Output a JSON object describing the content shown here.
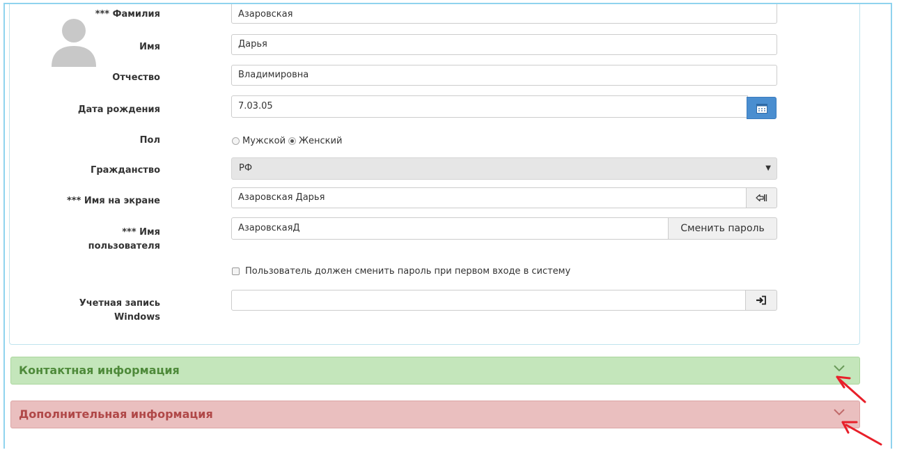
{
  "form": {
    "surname": {
      "label": "*** Фамилия",
      "value": "Азаровская"
    },
    "first_name": {
      "label": "Имя",
      "value": "Дарья"
    },
    "patronymic": {
      "label": "Отчество",
      "value": "Владимировна"
    },
    "birth_date": {
      "label": "Дата рождения",
      "value": "7.03.05"
    },
    "gender": {
      "label": "Пол",
      "options": [
        "Мужской",
        "Женский"
      ],
      "selected": "Женский"
    },
    "citizenship": {
      "label": "Гражданство",
      "selected": "РФ"
    },
    "display_name": {
      "label": "*** Имя на экране",
      "value": "Азаровская Дарья"
    },
    "username": {
      "label_line1": "*** Имя",
      "label_line2": "пользователя",
      "value": "АзаровскаяД",
      "change_password_label": "Сменить пароль"
    },
    "must_change_password": {
      "label": "Пользователь должен сменить пароль при первом входе в систему",
      "checked": false
    },
    "windows_account": {
      "label_line1": "Учетная запись",
      "label_line2": "Windows",
      "value": ""
    }
  },
  "sections": {
    "contact": {
      "title": "Контактная информация",
      "color": "#c4e6bb",
      "text_color": "#4e8a3a"
    },
    "extra": {
      "title": "Дополнительная информация",
      "color": "#eabfbf",
      "text_color": "#b04848"
    }
  },
  "icons": {
    "avatar": "avatar-placeholder-icon",
    "calendar": "calendar-icon",
    "generate": "login-arrow-icon",
    "windows_login": "sign-in-icon",
    "chevron": "chevron-down-icon"
  },
  "accent_color": "#4a8ed0",
  "annotation_color": "#e8202a"
}
